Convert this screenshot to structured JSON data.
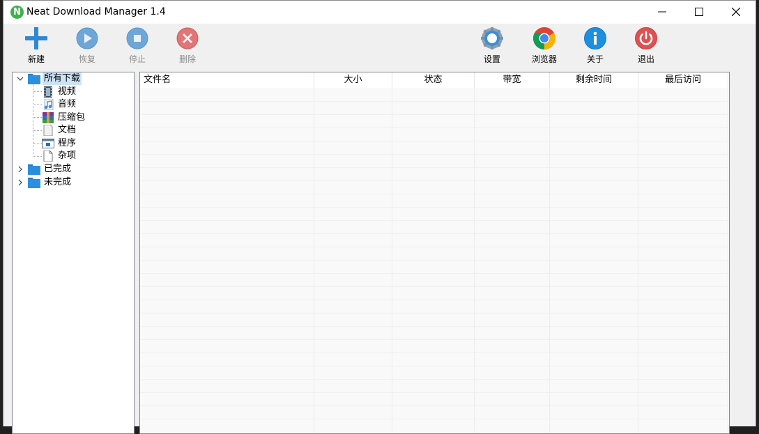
{
  "window": {
    "title": "Neat Download Manager 1.4",
    "app_icon_letter": "N"
  },
  "toolbar": {
    "new_label": "新建",
    "resume_label": "恢复",
    "stop_label": "停止",
    "delete_label": "删除",
    "settings_label": "设置",
    "browser_label": "浏览器",
    "about_label": "关于",
    "exit_label": "退出"
  },
  "tree": {
    "all_downloads": "所有下载",
    "categories": {
      "video": "视频",
      "audio": "音频",
      "archive": "压缩包",
      "document": "文档",
      "program": "程序",
      "misc": "杂项"
    },
    "completed": "已完成",
    "incomplete": "未完成"
  },
  "list": {
    "columns": {
      "filename": "文件名",
      "size": "大小",
      "status": "状态",
      "bandwidth": "带宽",
      "remaining": "剩余时间",
      "last_access": "最后访问"
    },
    "rows": []
  },
  "colors": {
    "accent_blue": "#2f88d6",
    "folder_blue": "#2b8fe0",
    "exit_red": "#e05050",
    "disabled_gray": "#8c8c8c"
  }
}
